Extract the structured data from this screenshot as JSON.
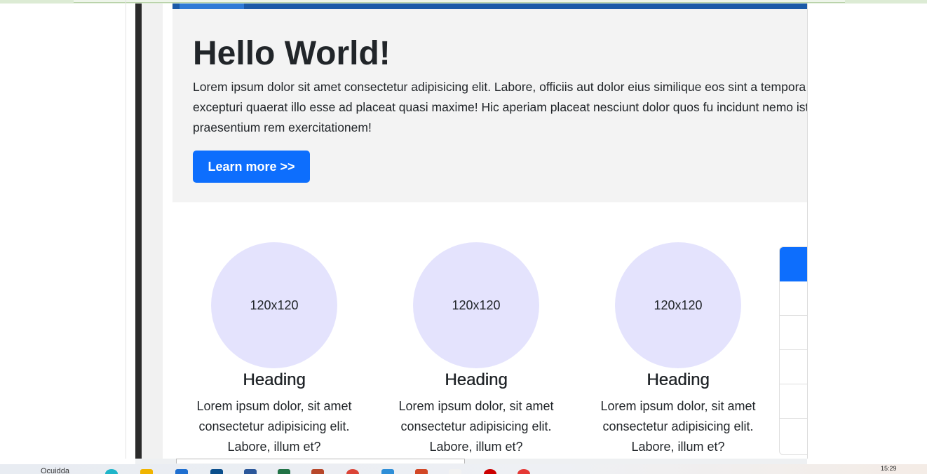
{
  "hero": {
    "title": "Hello World!",
    "text": "Lorem ipsum dolor sit amet consectetur adipisicing elit. Labore, officiis aut dolor eius similique eos sint a tempora excepturi quaerat illo esse ad placeat quasi maxime! Hic aperiam placeat nesciunt dolor quos fu incidunt nemo iste praesentium rem exercitationem!",
    "button_label": "Learn more >>"
  },
  "features": [
    {
      "image_label": "120x120",
      "heading": "Heading",
      "text": "Lorem ipsum dolor, sit amet consectetur adipisicing elit. Labore, illum et?"
    },
    {
      "image_label": "120x120",
      "heading": "Heading",
      "text": "Lorem ipsum dolor, sit amet consectetur adipisicing elit. Labore, illum et?"
    },
    {
      "image_label": "120x120",
      "heading": "Heading",
      "text": "Lorem ipsum dolor, sit amet consectetur adipisicing elit. Labore, illum et?"
    }
  ],
  "taskbar": {
    "search_text": "Ocuidda",
    "clock": "15:29"
  },
  "colors": {
    "primary": "#0d6efd",
    "jumbotron_bg": "#f3f3f3",
    "placeholder_circle": "#e4e3fd",
    "text": "#212529",
    "nav_bar": "#1c5aa8"
  }
}
